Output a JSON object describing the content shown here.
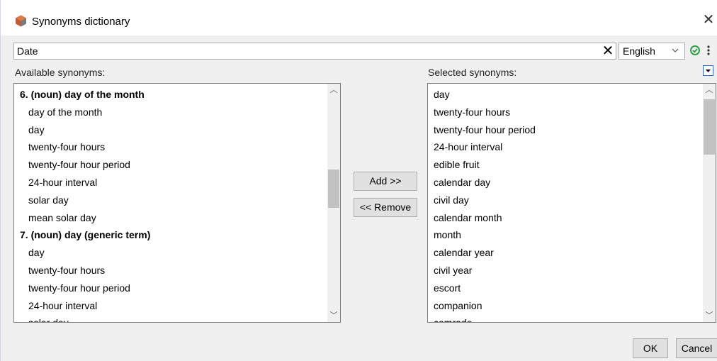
{
  "window": {
    "title": "Synonyms dictionary"
  },
  "search": {
    "value": "Date"
  },
  "language": {
    "selected": "English"
  },
  "available": {
    "label": "Available synonyms:",
    "items": [
      {
        "text": "6. (noun) day of the month",
        "header": true
      },
      {
        "text": "day of the month",
        "header": false
      },
      {
        "text": "day",
        "header": false
      },
      {
        "text": "twenty-four hours",
        "header": false
      },
      {
        "text": "twenty-four hour period",
        "header": false
      },
      {
        "text": "24-hour interval",
        "header": false
      },
      {
        "text": "solar day",
        "header": false
      },
      {
        "text": "mean solar day",
        "header": false
      },
      {
        "text": "7. (noun) day (generic term)",
        "header": true
      },
      {
        "text": "day",
        "header": false
      },
      {
        "text": "twenty-four hours",
        "header": false
      },
      {
        "text": "twenty-four hour period",
        "header": false
      },
      {
        "text": "24-hour interval",
        "header": false
      },
      {
        "text": "solar day",
        "header": false
      }
    ],
    "scroll_position": 0.48
  },
  "selected": {
    "label": "Selected synonyms:",
    "items": [
      "day",
      "twenty-four hours",
      "twenty-four hour period",
      "24-hour interval",
      "edible fruit",
      "calendar day",
      "civil day",
      "calendar month",
      "month",
      "calendar year",
      "civil year",
      "escort",
      "companion",
      "comrade"
    ],
    "scroll_position": 0.0
  },
  "buttons": {
    "add": "Add >>",
    "remove": "<< Remove",
    "ok": "OK",
    "cancel": "Cancel"
  },
  "icons": {
    "app": "synonyms-app-icon",
    "close": "close-icon",
    "clear": "clear-icon",
    "chevron": "chevron-down-icon",
    "check": "check-circle-icon",
    "menu": "more-vertical-icon",
    "dropdown": "dropdown-arrow-icon"
  },
  "colors": {
    "accent_blue": "#2a6cc4",
    "check_green": "#2ea043",
    "app_icon": "#c25a35"
  }
}
